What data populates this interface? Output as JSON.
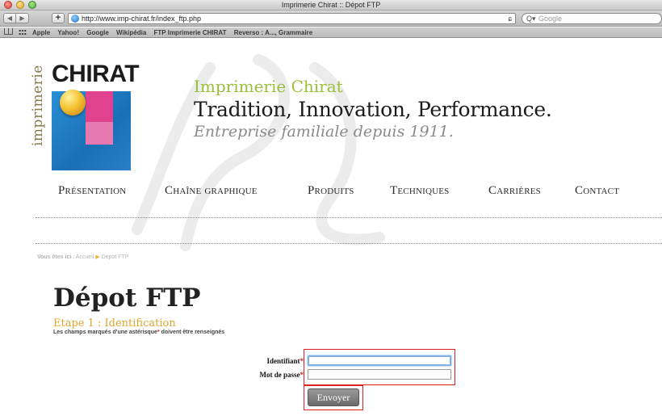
{
  "window": {
    "title": "Imprimerie Chirat :: Dépot FTP"
  },
  "toolbar": {
    "back_icon": "◀",
    "forward_icon": "▶",
    "add_icon": "+",
    "url": "http://www.imp-chirat.fr/index_ftp.php",
    "reload_icon": "ɕ",
    "search_icon": "Q▾",
    "search_placeholder": "Google"
  },
  "bookmarks": {
    "items": [
      "Apple",
      "Yahoo!",
      "Google",
      "Wikipédia",
      "FTP Imprimerie CHIRAT",
      "Reverso : A..., Grammaire"
    ]
  },
  "logo": {
    "word": "CHIRAT",
    "vertical_text": "imprimerie"
  },
  "header": {
    "name": "Imprimerie Chirat",
    "tagline": "Tradition, Innovation, Performance.",
    "since": "Entreprise familiale depuis 1911."
  },
  "nav": {
    "items": [
      "Présentation",
      "Chaîne graphique",
      "Produits",
      "Techniques",
      "Carrières",
      "Contact"
    ]
  },
  "breadcrumb": {
    "label": "Vous êtes ici",
    "sep": " : ",
    "home": "Accueil",
    "arrow": "▶",
    "current": "Dépot FTP"
  },
  "main": {
    "title": "Dépot FTP",
    "step": "Etape 1 : Identification",
    "note_before": "Les champs marqués d'une astérisque",
    "note_asterisk": "*",
    "note_after": " doivent être renseignés"
  },
  "form": {
    "login_label": "Identifiant",
    "password_label": "Mot de passe",
    "asterisk": "*",
    "login_value": "",
    "password_value": "",
    "submit_label": "Envoyer"
  },
  "colors": {
    "accent_green": "#9cbf3a",
    "accent_orange": "#e0a52f",
    "highlight_red": "#e02020"
  }
}
